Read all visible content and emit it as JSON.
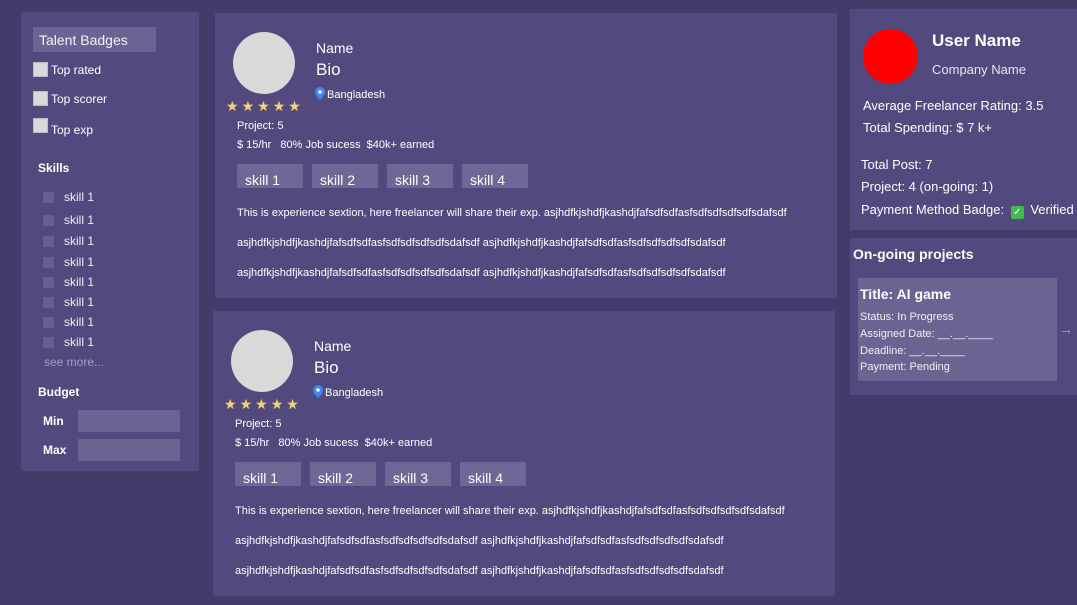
{
  "sidebar": {
    "talent_title": "Talent Badges",
    "badges": [
      "Top rated",
      "Top scorer",
      "Top exp"
    ],
    "skills_heading": "Skills",
    "skills": [
      "skill 1",
      "skill 1",
      "skill 1",
      "skill 1",
      "skill 1",
      "skill 1",
      "skill 1",
      "skill 1"
    ],
    "see_more": "see more...",
    "budget_heading": "Budget",
    "min_label": "Min",
    "max_label": "Max"
  },
  "freelancers": [
    {
      "name": "Name",
      "bio": "Bio",
      "location": "Bangladesh",
      "rating_stars": 5,
      "project": "Project: 5",
      "rate_line": "$ 15/hr   80% Job sucess  $40k+ earned",
      "skills": [
        "skill 1",
        "skill 2",
        "skill 3",
        "skill 4"
      ],
      "experience": [
        "This is experience sextion, here freelancer will share their exp. asjhdfkjshdfjkashdjfafsdfsdfasfsdfsdfsdfsdfsdafsdf",
        "asjhdfkjshdfjkashdjfafsdfsdfasfsdfsdfsdfsdfsdafsdf asjhdfkjshdfjkashdjfafsdfsdfasfsdfsdfsdfsdfsdafsdf",
        "asjhdfkjshdfjkashdjfafsdfsdfasfsdfsdfsdfsdfsdafsdf asjhdfkjshdfjkashdjfafsdfsdfasfsdfsdfsdfsdfsdafsdf"
      ]
    },
    {
      "name": "Name",
      "bio": "Bio",
      "location": "Bangladesh",
      "rating_stars": 5,
      "project": "Project: 5",
      "rate_line": "$ 15/hr   80% Job sucess  $40k+ earned",
      "skills": [
        "skill 1",
        "skill 2",
        "skill 3",
        "skill 4"
      ],
      "experience": [
        "This is experience sextion, here freelancer will share their exp. asjhdfkjshdfjkashdjfafsdfsdfasfsdfsdfsdfsdfsdafsdf",
        "asjhdfkjshdfjkashdjfafsdfsdfasfsdfsdfsdfsdfsdafsdf asjhdfkjshdfjkashdjfafsdfsdfasfsdfsdfsdfsdfsdafsdf",
        "asjhdfkjshdfjkashdjfafsdfsdfasfsdfsdfsdfsdfsdafsdf asjhdfkjshdfjkashdjfafsdfsdfasfsdfsdfsdfsdfsdafsdf"
      ]
    }
  ],
  "user": {
    "name": "User Name",
    "company": "Company Name",
    "avg_rating": "Average Freelancer Rating: 3.5",
    "total_spending": "Total Spending: $ 7 k+",
    "total_post": "Total Post: 7",
    "project": "Project: 4 (on-going: 1)",
    "payment_badge_label": "Payment Method Badge:",
    "payment_badge_status": "Verified",
    "avatar_color": "#ff0000"
  },
  "ongoing": {
    "heading": "On-going projects",
    "projects": [
      {
        "title": "Title: AI game",
        "status": "Status: In Progress",
        "assigned": "Assigned Date: __.__.____",
        "deadline": "Deadline: __.__.____",
        "payment": "Payment: Pending"
      }
    ]
  },
  "icons": {
    "star": "star-icon",
    "location": "location-pin-icon",
    "verified": "check-icon",
    "next": "arrow-right-icon"
  },
  "colors": {
    "background": "#433c6b",
    "panel": "#524a7e",
    "chip": "#6e6896",
    "star": "#f3d27a"
  }
}
